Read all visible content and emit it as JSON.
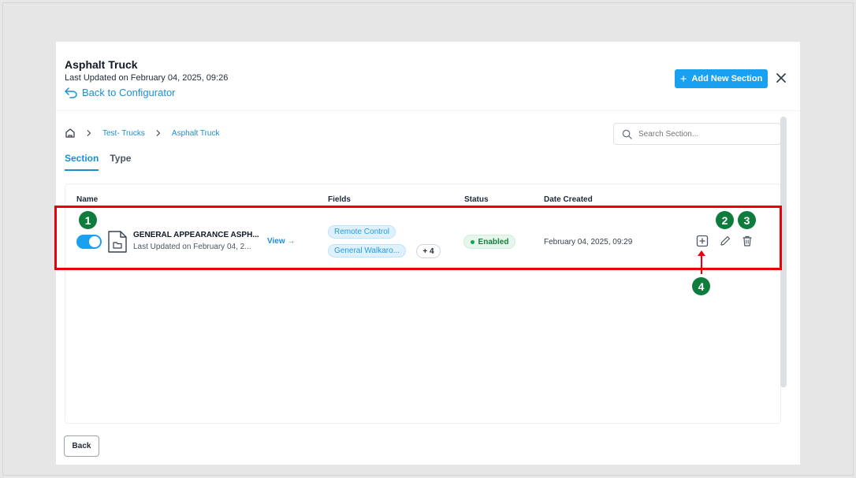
{
  "header": {
    "title": "Asphalt Truck",
    "last_updated": "Last Updated on February 04, 2025, 09:26",
    "back_link": "Back to Configurator",
    "add_button": "Add New Section"
  },
  "breadcrumb": {
    "items": [
      "Test- Trucks",
      "Asphalt Truck"
    ]
  },
  "search": {
    "placeholder": "Search Section..."
  },
  "tabs": [
    {
      "label": "Section",
      "active": true
    },
    {
      "label": "Type",
      "active": false
    }
  ],
  "table": {
    "columns": [
      "Name",
      "Fields",
      "Status",
      "Date Created"
    ],
    "rows": [
      {
        "name": "GENERAL APPEARANCE ASPH...",
        "updated": "Last Updated on February 04, 2...",
        "view": "View",
        "fields": [
          "Remote Control",
          "General Walkaro..."
        ],
        "more": "+ 4",
        "status": "Enabled",
        "date": "February 04, 2025, 09:29"
      }
    ]
  },
  "footer": {
    "back_button": "Back"
  },
  "annotations": {
    "badges": [
      "1",
      "2",
      "3",
      "4"
    ],
    "highlight_color": "#e8000d",
    "badge_color": "#0d7c3d"
  },
  "colors": {
    "accent": "#1aa0f0",
    "link": "#1a8fd6",
    "status_green": "#15803d"
  }
}
